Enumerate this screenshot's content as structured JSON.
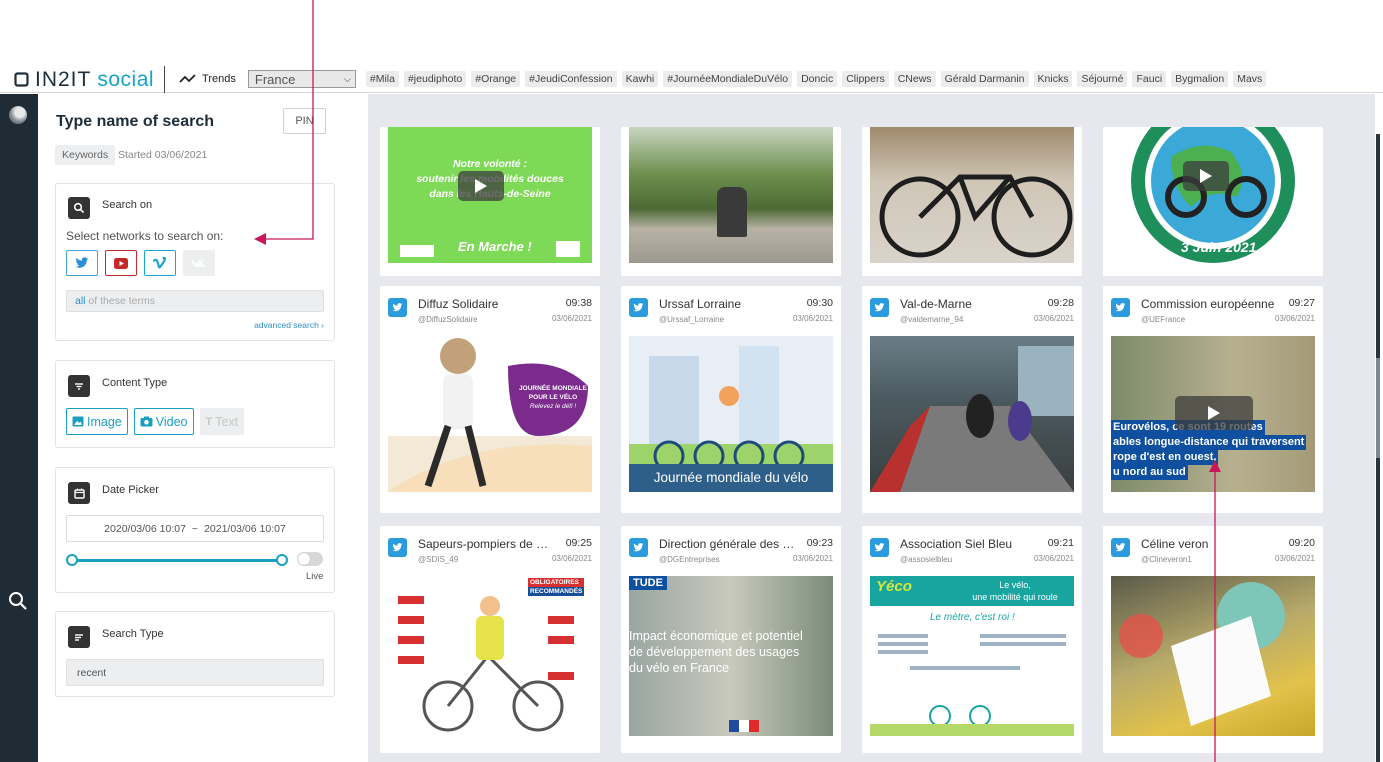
{
  "header": {
    "brand_a": "IN2IT",
    "brand_b": "social",
    "trends_label": "Trends",
    "country": "France",
    "tags": [
      "#Mila",
      "#jeudiphoto",
      "#Orange",
      "#JeudiConfession",
      "Kawhi",
      "#JournéeMondialeDuVélo",
      "Doncic",
      "Clippers",
      "CNews",
      "Gérald Darmanin",
      "Knicks",
      "Séjourné",
      "Fauci",
      "Bygmalion",
      "Mavs"
    ]
  },
  "panel": {
    "title": "Type name of search",
    "pin_label": "PIN",
    "keywords_badge": "Keywords",
    "started": "Started 03/06/2021",
    "search_on": {
      "label": "Search on",
      "select_text": "Select networks to search on:",
      "terms_strong": "all",
      "terms_rest": " of these terms",
      "advanced": "advanced search ›"
    },
    "content_type": {
      "label": "Content Type",
      "image": "Image",
      "video": "Video",
      "text": "Text"
    },
    "date_picker": {
      "label": "Date Picker",
      "from": "2020/03/06 10:07",
      "sep": "~",
      "to": "2021/03/06 10:07",
      "live": "Live"
    },
    "search_type": {
      "label": "Search Type",
      "value": "recent"
    }
  },
  "posts_row2": [
    {
      "name": "Diffuz Solidaire",
      "handle": "@DiffuzSolidaire",
      "time": "09:38",
      "date": "03/06/2021"
    },
    {
      "name": "Urssaf Lorraine",
      "handle": "@Urssaf_Lorraine",
      "time": "09:30",
      "date": "03/06/2021"
    },
    {
      "name": "Val-de-Marne",
      "handle": "@valdemarne_94",
      "time": "09:28",
      "date": "03/06/2021"
    },
    {
      "name": "Commission européenne",
      "handle": "@UEFrance",
      "time": "09:27",
      "date": "03/06/2021"
    }
  ],
  "posts_row3": [
    {
      "name": "Sapeurs-pompiers de Maine-et-Loire",
      "handle": "@SDIS_49",
      "time": "09:25",
      "date": "03/06/2021"
    },
    {
      "name": "Direction générale des Entreprises",
      "handle": "@DGEntreprises",
      "time": "09:23",
      "date": "03/06/2021"
    },
    {
      "name": "Association Siel Bleu",
      "handle": "@assosielbleu",
      "time": "09:21",
      "date": "03/06/2021"
    },
    {
      "name": "Céline veron",
      "handle": "@Clineveron1",
      "time": "09:20",
      "date": "03/06/2021"
    }
  ],
  "media_text": {
    "r1c1_line1": "Notre volonté :",
    "r1c1_line2": "soutenir les mobilités douces",
    "r1c1_line3": "dans les Hauts-de-Seine",
    "r1c1_footer": "En Marche !",
    "r1c4_ring": "3 Juin 2021",
    "r2c1_badge1": "JOURNÉE MONDIALE",
    "r2c1_badge2": "POUR LE VÉLO",
    "r2c1_badge3": "Relevez le défi !",
    "r2c2_caption": "Journée mondiale du vélo",
    "r2c4_line1": "Eurovélos, ce sont 19 routes",
    "r2c4_line2": "ables longue-distance qui traversent",
    "r2c4_line3": "rope d'est en ouest,",
    "r2c4_line4": "u nord au sud",
    "r3c1_tag1": "OBLIGATOIRES",
    "r3c1_tag2": "RECOMMANDÉS",
    "r3c2_tag": "TUDE",
    "r3c2_line1": "Impact économique et potentiel",
    "r3c2_line2": "de développement des usages",
    "r3c2_line3": "du vélo en France",
    "r3c3_brand": "Yéco",
    "r3c3_title1": "Le vélo,",
    "r3c3_title2": "une mobilité qui roule",
    "r3c3_sub": "Le mètre, c'est roi !"
  },
  "colors": {
    "accent": "#1a9fc0",
    "twitter": "#2a9bdc",
    "rail": "#1f2b35",
    "grid_bg": "#e7e8ee",
    "annotation": "#c8185a"
  }
}
